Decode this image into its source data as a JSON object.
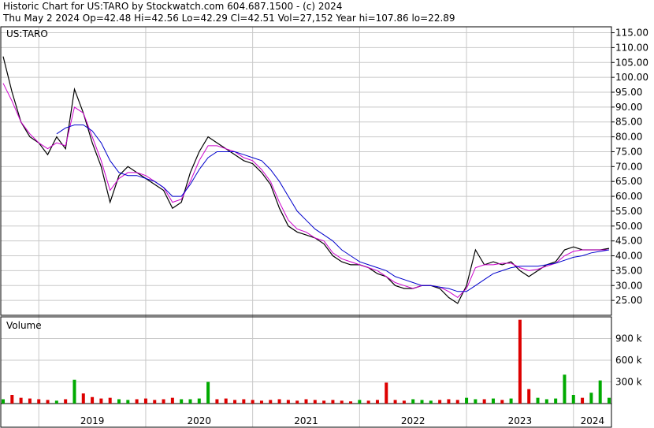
{
  "header": {
    "line1": "Historic Chart for US:TARO by Stockwatch.com 604.687.1500 - (c) 2024",
    "line2": "Thu May  2 2024   Op=42.48   Hi=42.56   Lo=42.29   Cl=42.51   Vol=27,152   Year hi=107.86   lo=22.89"
  },
  "symbol_label": "US:TARO",
  "volume_label": "Volume",
  "colors": {
    "price_bars": "#000000",
    "ma_short": "#cc00cc",
    "ma_long": "#0000cc",
    "volume_up": "#00aa00",
    "volume_down": "#dd0000",
    "grid": "#c8c8c8"
  },
  "chart_data": [
    {
      "type": "line",
      "name": "price",
      "ylim": [
        20,
        117
      ],
      "yticks": [
        "115.00",
        "110.00",
        "105.00",
        "100.00",
        "95.00",
        "90.00",
        "85.00",
        "80.00",
        "75.00",
        "70.00",
        "65.00",
        "60.00",
        "55.00",
        "50.00",
        "45.00",
        "40.00",
        "35.00",
        "30.00",
        "25.00"
      ],
      "x_categories": [
        "2019",
        "2020",
        "2021",
        "2022",
        "2023",
        "2024"
      ],
      "x": [
        "2018-09",
        "2018-10",
        "2018-11",
        "2018-12",
        "2019-01",
        "2019-02",
        "2019-03",
        "2019-04",
        "2019-05",
        "2019-06",
        "2019-07",
        "2019-08",
        "2019-09",
        "2019-10",
        "2019-11",
        "2019-12",
        "2020-01",
        "2020-02",
        "2020-03",
        "2020-04",
        "2020-05",
        "2020-06",
        "2020-07",
        "2020-08",
        "2020-09",
        "2020-10",
        "2020-11",
        "2020-12",
        "2021-01",
        "2021-02",
        "2021-03",
        "2021-04",
        "2021-05",
        "2021-06",
        "2021-07",
        "2021-08",
        "2021-09",
        "2021-10",
        "2021-11",
        "2021-12",
        "2022-01",
        "2022-02",
        "2022-03",
        "2022-04",
        "2022-05",
        "2022-06",
        "2022-07",
        "2022-08",
        "2022-09",
        "2022-10",
        "2022-11",
        "2022-12",
        "2023-01",
        "2023-02",
        "2023-03",
        "2023-04",
        "2023-05",
        "2023-06",
        "2023-07",
        "2023-08",
        "2023-09",
        "2023-10",
        "2023-11",
        "2023-12",
        "2024-01",
        "2024-02",
        "2024-03",
        "2024-04",
        "2024-05"
      ],
      "series": [
        {
          "values": [
            107,
            95,
            85,
            80,
            78,
            74,
            80,
            76,
            96,
            88,
            78,
            70,
            58,
            67,
            70,
            68,
            66,
            64,
            62,
            56,
            58,
            68,
            75,
            80,
            78,
            76,
            74,
            72,
            71,
            68,
            64,
            56,
            50,
            48,
            47,
            46,
            44,
            40,
            38,
            37,
            37,
            36,
            34,
            33,
            30,
            29,
            29,
            30,
            30,
            29,
            26,
            24,
            30,
            42,
            37,
            38,
            37,
            38,
            35,
            33,
            35,
            37,
            38,
            42,
            43,
            42,
            42,
            42,
            42.51
          ]
        },
        {
          "values": [
            98,
            92,
            85,
            81,
            78,
            76,
            78,
            77,
            90,
            88,
            80,
            72,
            62,
            66,
            68,
            68,
            67,
            65,
            63,
            58,
            59,
            65,
            72,
            77,
            77,
            76,
            75,
            73,
            72,
            69,
            65,
            58,
            52,
            49,
            48,
            46,
            45,
            41,
            39,
            38,
            37,
            36,
            35,
            33,
            31,
            30,
            29,
            30,
            30,
            29.5,
            28,
            26,
            29,
            36,
            37,
            37,
            37.5,
            37.5,
            36,
            35,
            35.5,
            36.5,
            37.5,
            40,
            41.5,
            42,
            42,
            42,
            42
          ]
        },
        {
          "values": [
            null,
            null,
            null,
            null,
            null,
            null,
            81,
            83,
            84,
            84,
            82,
            78,
            72,
            68,
            67,
            67,
            66,
            65,
            63,
            60,
            60,
            64,
            69,
            73,
            75,
            75,
            75,
            74,
            73,
            72,
            69,
            65,
            60,
            55,
            52,
            49,
            47,
            45,
            42,
            40,
            38,
            37,
            36,
            35,
            33,
            32,
            31,
            30,
            30,
            29.5,
            29,
            28,
            28,
            30,
            32,
            34,
            35,
            36,
            36.5,
            36.5,
            36.5,
            37,
            37.5,
            38.5,
            39.5,
            40,
            41,
            41.5,
            42
          ]
        }
      ]
    },
    {
      "type": "bar",
      "name": "volume",
      "ylim": [
        0,
        1200
      ],
      "yticks": [
        "900 k",
        "600 k",
        "300 k"
      ],
      "x": [
        "2018-09",
        "2018-10",
        "2018-11",
        "2018-12",
        "2019-01",
        "2019-02",
        "2019-03",
        "2019-04",
        "2019-05",
        "2019-06",
        "2019-07",
        "2019-08",
        "2019-09",
        "2019-10",
        "2019-11",
        "2019-12",
        "2020-01",
        "2020-02",
        "2020-03",
        "2020-04",
        "2020-05",
        "2020-06",
        "2020-07",
        "2020-08",
        "2020-09",
        "2020-10",
        "2020-11",
        "2020-12",
        "2021-01",
        "2021-02",
        "2021-03",
        "2021-04",
        "2021-05",
        "2021-06",
        "2021-07",
        "2021-08",
        "2021-09",
        "2021-10",
        "2021-11",
        "2021-12",
        "2022-01",
        "2022-02",
        "2022-03",
        "2022-04",
        "2022-05",
        "2022-06",
        "2022-07",
        "2022-08",
        "2022-09",
        "2022-10",
        "2022-11",
        "2022-12",
        "2023-01",
        "2023-02",
        "2023-03",
        "2023-04",
        "2023-05",
        "2023-06",
        "2023-07",
        "2023-08",
        "2023-09",
        "2023-10",
        "2023-11",
        "2023-12",
        "2024-01",
        "2024-02",
        "2024-03",
        "2024-04",
        "2024-05"
      ],
      "values": [
        60,
        120,
        80,
        70,
        60,
        50,
        40,
        60,
        330,
        140,
        90,
        70,
        80,
        60,
        50,
        60,
        70,
        50,
        60,
        80,
        60,
        60,
        70,
        300,
        60,
        70,
        50,
        60,
        50,
        40,
        50,
        60,
        50,
        40,
        60,
        50,
        40,
        50,
        40,
        30,
        50,
        40,
        50,
        290,
        50,
        40,
        60,
        50,
        40,
        50,
        60,
        50,
        80,
        60,
        60,
        70,
        50,
        70,
        1160,
        200,
        80,
        60,
        70,
        400,
        120,
        80,
        150,
        320,
        80
      ]
    }
  ]
}
